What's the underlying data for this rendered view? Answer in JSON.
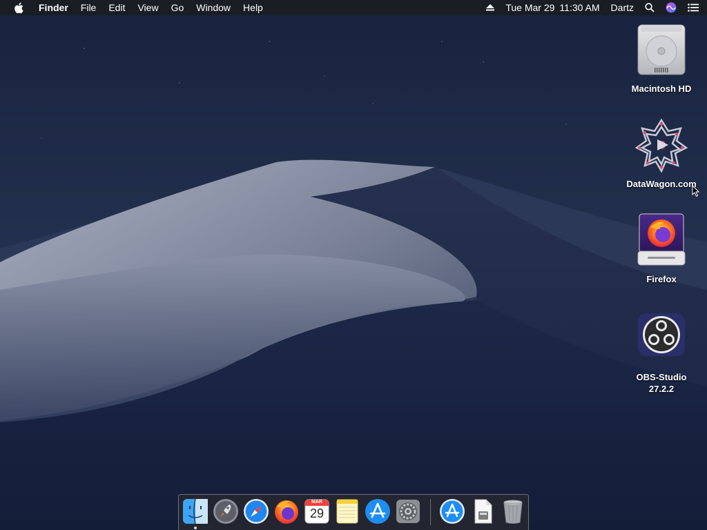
{
  "menubar": {
    "app_name": "Finder",
    "menus": [
      "File",
      "Edit",
      "View",
      "Go",
      "Window",
      "Help"
    ],
    "status": {
      "date": "Tue Mar 29",
      "time": "11:30 AM",
      "user": "Dartz"
    },
    "icons": [
      "apple-icon",
      "eject-icon",
      "spotlight-icon",
      "siri-icon",
      "notification-center-icon"
    ]
  },
  "desktop_icons": [
    {
      "label": "Macintosh HD",
      "icon": "hard-drive-icon"
    },
    {
      "label": "DataWagon.com",
      "icon": "datawagon-icon"
    },
    {
      "label": "Firefox",
      "icon": "firefox-disk-icon"
    },
    {
      "label": "OBS-Studio 27.2.2",
      "label_line1": "OBS-Studio",
      "label_line2": "27.2.2",
      "icon": "obs-icon"
    }
  ],
  "dock": {
    "items": [
      "finder-icon",
      "launchpad-icon",
      "safari-icon",
      "firefox-icon",
      "calendar-icon",
      "notes-icon",
      "app-store-icon",
      "system-preferences-icon",
      "app-store-downloads-icon",
      "document-icon",
      "trash-icon"
    ],
    "calendar": {
      "month": "MAR",
      "day": "29"
    }
  },
  "colors": {
    "sky_top": "#16213d",
    "sky_bottom": "#0f1a33",
    "dune_light": "#8c93a8",
    "dune_dark": "#1c2747",
    "menubar": "#1c1c20"
  }
}
